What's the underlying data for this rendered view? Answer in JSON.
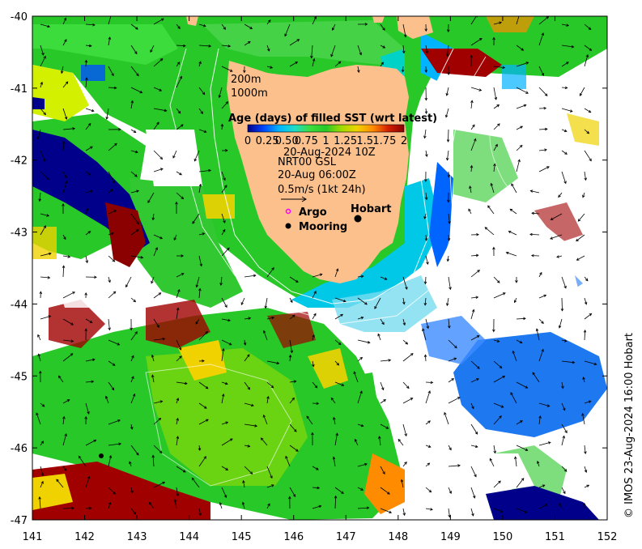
{
  "map": {
    "lon_range": [
      141,
      152
    ],
    "lat_range": [
      -47,
      -40
    ],
    "x_ticks": [
      "141",
      "142",
      "143",
      "144",
      "145",
      "146",
      "147",
      "148",
      "149",
      "150",
      "151",
      "152"
    ],
    "y_ticks": [
      "-40",
      "-41",
      "-42",
      "-43",
      "-44",
      "-45",
      "-46",
      "-47"
    ]
  },
  "depth_labels": [
    "200m",
    "1000m"
  ],
  "colorbar": {
    "title": "Age (days) of filled SST (wrt latest)",
    "tick_labels": [
      "0",
      "0.25",
      "0.50",
      "0.75",
      "1",
      "1.25",
      "1.5",
      "1.75",
      "2"
    ],
    "colors": [
      "#00008b",
      "#0044ff",
      "#00b4ff",
      "#1edcc8",
      "#3cdc3c",
      "#28c828",
      "#a0dc00",
      "#f0d200",
      "#ff8c00",
      "#d21e00",
      "#8b0000"
    ]
  },
  "overlay": {
    "date_line": "20-Aug-2024 10Z",
    "product": "NRT00 GSL",
    "product_time": "20-Aug 06:00Z",
    "scale_text": "0.5m/s (1kt 24h)"
  },
  "legend": {
    "argo_label": "Argo",
    "mooring_label": "Mooring",
    "city_label": "Hobart",
    "argo_color": "#ff00ff"
  },
  "credit": "© IMOS 23-Aug-2024 16:00 Hobart"
}
